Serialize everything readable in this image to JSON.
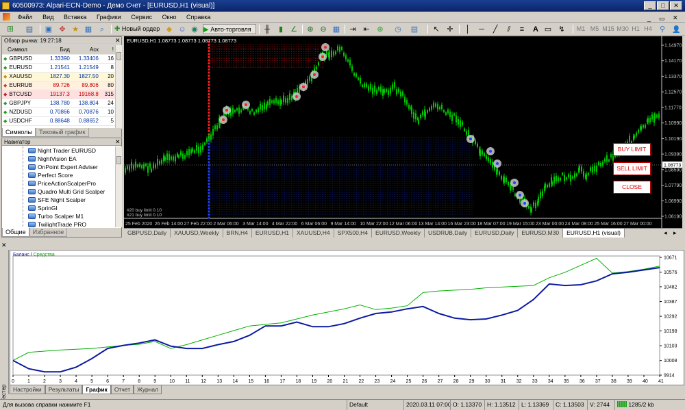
{
  "window": {
    "title": "60500973: Alpari-ECN-Demo - Демо Счет - [EURUSD,H1 (visual)]"
  },
  "menu": [
    "Файл",
    "Вид",
    "Вставка",
    "Графики",
    "Сервис",
    "Окно",
    "Справка"
  ],
  "toolbar": {
    "new_order": "Новый ордер",
    "auto_trading": "Авто-торговля",
    "timeframes": [
      "M1",
      "M5",
      "M15",
      "M30",
      "H1",
      "H4"
    ]
  },
  "market_watch": {
    "header": "Обзор рынка: 19:27:18",
    "columns": [
      "Символ",
      "Бид",
      "Аск",
      "!"
    ],
    "rows": [
      {
        "symbol": "GBPUSD",
        "bid": "1.33390",
        "ask": "1.33406",
        "spread": "16"
      },
      {
        "symbol": "EURUSD",
        "bid": "1.21541",
        "ask": "1.21549",
        "spread": "8"
      },
      {
        "symbol": "XAUUSD",
        "bid": "1827.30",
        "ask": "1827.50",
        "spread": "20"
      },
      {
        "symbol": "EURRUB",
        "bid": "89.726",
        "ask": "89.806",
        "spread": "80"
      },
      {
        "symbol": "BTCUSD",
        "bid": "19137.3",
        "ask": "19168.8",
        "spread": "315"
      },
      {
        "symbol": "GBPJPY",
        "bid": "138.780",
        "ask": "138.804",
        "spread": "24"
      },
      {
        "symbol": "NZDUSD",
        "bid": "0.70866",
        "ask": "0.70876",
        "spread": "10"
      },
      {
        "symbol": "USDCHF",
        "bid": "0.88648",
        "ask": "0.88652",
        "spread": "5"
      }
    ],
    "tabs": [
      "Символы",
      "Тиковый график"
    ]
  },
  "navigator": {
    "header": "Навигатор",
    "items": [
      "Night Trader EURUSD",
      "NightVision EA",
      "OnPoint Expert Adviser",
      "Perfect Score",
      "PriceActionScalperPro",
      "Quadro Multi Grid Scalper",
      "SFE Night Scalper",
      "SprinGI",
      "Turbo Scalper M1",
      "TwilightTrade PRO"
    ],
    "tabs": [
      "Общие",
      "Избранное"
    ]
  },
  "chart": {
    "label": "EURUSD,H1  1.08773 1.08773 1.08773 1.08773",
    "price_levels": [
      "1.14970",
      "1.14170",
      "1.13370",
      "1.12570",
      "1.11770",
      "1.10990",
      "1.10190",
      "1.09390",
      "1.08590",
      "1.07790",
      "1.06990",
      "1.06190"
    ],
    "current_price": "1.08773",
    "time_labels": [
      "25 Feb 2020",
      "26 Feb 14:00",
      "27 Feb 22:00",
      "2 Mar 06:00",
      "3 Mar 14:00",
      "4 Mar 22:00",
      "6 Mar 06:00",
      "9 Mar 14:00",
      "10 Mar 22:00",
      "12 Mar 06:00",
      "13 Mar 14:00",
      "16 Mar 23:00",
      "18 Mar 07:00",
      "19 Mar 15:00",
      "23 Mar 00:00",
      "24 Mar 08:00",
      "25 Mar 16:00",
      "27 Mar 00:00"
    ],
    "buy_limit_labels": [
      "#20 buy limit 0.10",
      "#21 buy limit 0.10"
    ],
    "buttons": {
      "buy_limit": "BUY LIMIT",
      "sell_limit": "SELL LIMIT",
      "close": "CLOSE"
    },
    "series_colors": {
      "candles": "#00c800",
      "background": "#000000",
      "buy": "#2040ff",
      "sell": "#ff2020"
    }
  },
  "chart_tabs": [
    "GBPUSD,Daily",
    "XAUUSD,Weekly",
    "BRN,H4",
    "EURUSD,H1",
    "XAUUSD,H4",
    "SPX500,H4",
    "EURUSD,Weekly",
    "USDRUB,Daily",
    "EURUSD,Daily",
    "EURUSD,M30",
    "EURUSD,H1 (visual)"
  ],
  "tester": {
    "side_label": "Тестер",
    "legend": {
      "balance": "Баланс",
      "sep": "/",
      "equity": "Средства"
    },
    "tabs": [
      "Настройки",
      "Результаты",
      "График",
      "Отчет",
      "Журнал"
    ],
    "colors": {
      "balance": "#0a1aa0",
      "equity": "#00b000"
    },
    "chart_data": {
      "type": "line",
      "x": [
        0,
        1,
        2,
        3,
        4,
        5,
        6,
        7,
        8,
        9,
        10,
        11,
        12,
        13,
        14,
        15,
        16,
        17,
        18,
        19,
        20,
        21,
        22,
        23,
        24,
        25,
        26,
        27,
        28,
        29,
        30,
        31,
        32,
        33,
        34,
        35,
        36,
        37,
        38,
        39,
        40,
        41
      ],
      "y_ticks": [
        "10671",
        "10576",
        "10482",
        "10387",
        "10292",
        "10198",
        "10103",
        "10008",
        "9914"
      ],
      "ylim": [
        9914,
        10671
      ],
      "series": [
        {
          "name": "Баланс",
          "values": [
            10008,
            9955,
            9935,
            9935,
            9965,
            10020,
            10085,
            10105,
            10120,
            10140,
            10100,
            10085,
            10085,
            10110,
            10130,
            10170,
            10230,
            10230,
            10255,
            10225,
            10225,
            10245,
            10280,
            10310,
            10320,
            10340,
            10355,
            10310,
            10280,
            10270,
            10275,
            10300,
            10330,
            10400,
            10500,
            10490,
            10495,
            10520,
            10565,
            10575,
            10590,
            10605
          ]
        },
        {
          "name": "Средства",
          "values": [
            10008,
            10060,
            10068,
            10075,
            10080,
            10085,
            10095,
            10105,
            10112,
            10130,
            10085,
            10110,
            10140,
            10170,
            10200,
            10230,
            10240,
            10250,
            10275,
            10300,
            10320,
            10340,
            10365,
            10335,
            10345,
            10360,
            10445,
            10455,
            10460,
            10465,
            10475,
            10480,
            10485,
            10490,
            10540,
            10575,
            10620,
            10665,
            10570,
            10580,
            10595,
            10615
          ]
        }
      ]
    }
  },
  "statusbar": {
    "help": "Для вызова справки нажмите F1",
    "profile": "Default",
    "datetime": "2020.03.11 07:00",
    "open": "O: 1.13370",
    "high": "H: 1.13512",
    "low": "L: 1.13369",
    "close": "C: 1.13503",
    "volume": "V: 2744",
    "traffic": "1285/2 kb"
  }
}
